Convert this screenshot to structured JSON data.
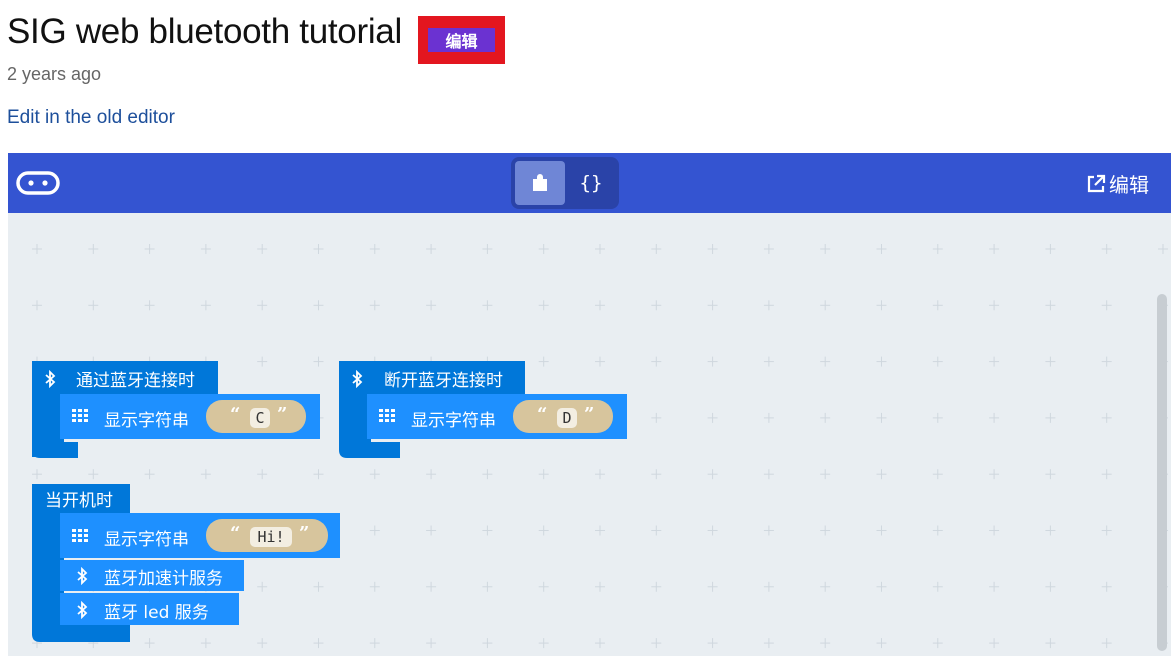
{
  "page": {
    "title": "SIG web bluetooth tutorial",
    "edit_badge": "编辑",
    "meta": "2 years ago",
    "old_editor_link": "Edit in the old editor"
  },
  "editor": {
    "toolbar": {
      "device_icon": "microbit-icon",
      "blocks_view_icon": "puzzle-icon",
      "js_view_label": "{}",
      "edit_label": "编辑",
      "edit_icon": "external-link-icon",
      "bg_color": "#3454d1"
    },
    "colors": {
      "block_bluetooth": "#0077d9",
      "block_basic": "#1e90ff",
      "string_block": "#d7c59d",
      "canvas": "#e9eef2"
    },
    "blocks": {
      "on_connected": {
        "hat_label": "通过蓝牙连接时",
        "inner_label": "显示字符串",
        "string_value": "C"
      },
      "on_disconnected": {
        "hat_label": "断开蓝牙连接时",
        "inner_label": "显示字符串",
        "string_value": "D"
      },
      "on_start": {
        "hat_label": "当开机时",
        "inner_label": "显示字符串",
        "string_value": "Hi!",
        "accel_service_label": "蓝牙加速计服务",
        "led_service_label": "蓝牙 led 服务"
      },
      "open_quote": "“",
      "close_quote": "”"
    }
  }
}
